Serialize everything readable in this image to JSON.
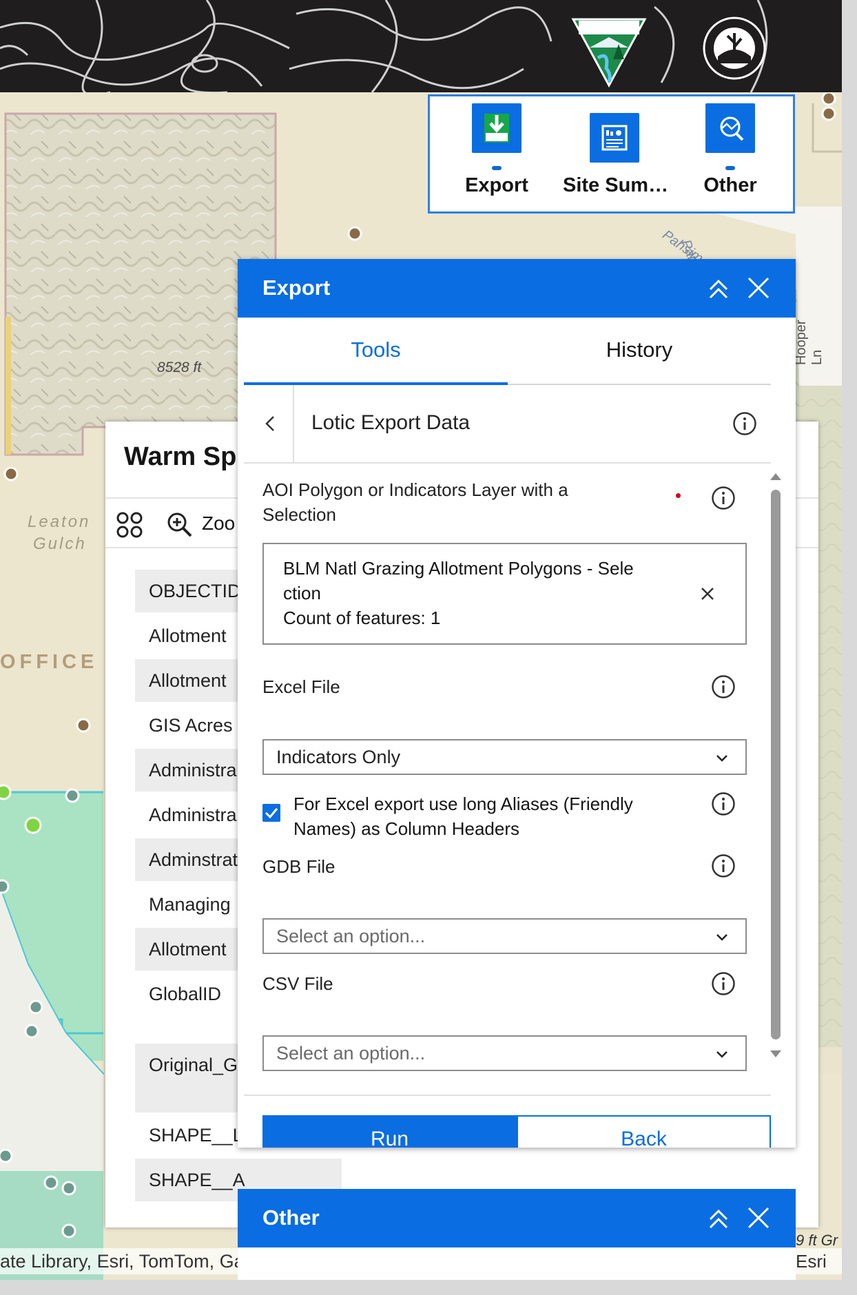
{
  "colors": {
    "accent": "#0a6de1",
    "header_dark": "#1f1d1d",
    "map_tan": "#ece6cf",
    "map_green": "#a9e3c3",
    "widget_green": "#17a64a"
  },
  "map": {
    "elevation_label": "8528 ft",
    "place_label_1": "Leaton",
    "place_label_2": "Gulch",
    "office_label": "OFFICE",
    "road_label_1": "Patterson",
    "road_label_2": "Pahsimeroi",
    "road_label_3": "Hooper Ln",
    "edge_label": "9 ft Gr",
    "attribution_left": "ate Library, Esri, TomTom, Ga",
    "attribution_right": "Esri"
  },
  "header": {
    "logo_left_icon": "blm-shield-logo",
    "logo_right_icon": "aim-circle-logo"
  },
  "widget_bar": {
    "items": [
      {
        "label": "Export",
        "icon": "download-icon",
        "color": "#17a64a"
      },
      {
        "label": "Site Sum…",
        "icon": "report-icon",
        "color": "#0a6de1"
      },
      {
        "label": "Other",
        "icon": "search-chart-icon",
        "color": "#0a6de1"
      }
    ]
  },
  "attribute_panel": {
    "title": "Warm Sp",
    "toolbar_zoom": "Zoo",
    "rows": [
      "OBJECTID",
      "Allotment",
      "Allotment",
      "GIS Acres",
      "Administra",
      "Administra",
      "Adminstrat",
      "Managing",
      "Allotment",
      "GlobalID",
      "Original_G",
      "SHAPE__Le",
      "SHAPE__A"
    ]
  },
  "export_panel": {
    "title": "Export",
    "tabs": [
      "Tools",
      "History"
    ],
    "tool_title": "Lotic Export Data",
    "aoi": {
      "label_line1": "AOI Polygon or Indicators Layer with a",
      "label_line2": "Selection",
      "selection_line1": "BLM Natl Grazing Allotment Polygons - Sele",
      "selection_line2": "ction",
      "selection_count": "Count of features: 1"
    },
    "excel": {
      "label": "Excel File",
      "value": "Indicators Only"
    },
    "checkbox": {
      "line1": "For Excel export use long Aliases (Friendly",
      "line2": "Names) as Column Headers",
      "checked": true
    },
    "gdb": {
      "label": "GDB File",
      "placeholder": "Select an option..."
    },
    "csv": {
      "label": "CSV File",
      "placeholder": "Select an option..."
    },
    "run_label": "Run",
    "back_label": "Back"
  },
  "other_panel": {
    "title": "Other"
  }
}
